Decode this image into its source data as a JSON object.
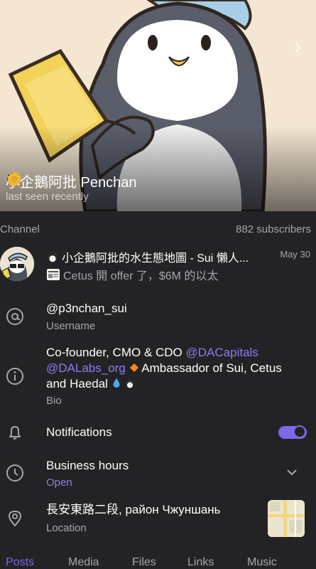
{
  "profile": {
    "name": "小企鵝阿批 Penchan",
    "status": "last seen recently"
  },
  "meta": {
    "type_label": "Channel",
    "subscribers": "882 subscribers"
  },
  "channel": {
    "title": "小企鵝阿批的水生態地圖 - Sui 懶人...",
    "date": "May 30",
    "preview": "Cetus 開 offer 了，$6M 的以太"
  },
  "username": {
    "value": "@p3nchan_sui",
    "label": "Username"
  },
  "bio": {
    "text1": "Co-founder, CMO & CDO ",
    "link1": "@DACapitals",
    "link2": "@DALabs_org",
    "text2": " Ambassador of Sui, Cetus",
    "text3": "and Haedal",
    "label": "Bio"
  },
  "notifications": {
    "label": "Notifications",
    "enabled": true
  },
  "business_hours": {
    "label": "Business hours",
    "status": "Open"
  },
  "location": {
    "address": "長安東路二段, район Чжуншань",
    "label": "Location"
  },
  "tabs": [
    "Posts",
    "Media",
    "Files",
    "Links",
    "Music"
  ],
  "colors": {
    "accent": "#7b69e6",
    "background": "#232325",
    "secondary_text": "#a6a6ab"
  },
  "icons": {
    "username": "at-icon",
    "bio": "info-icon",
    "notifications": "bell-icon",
    "business_hours": "clock-icon",
    "location": "location-pin-icon"
  }
}
